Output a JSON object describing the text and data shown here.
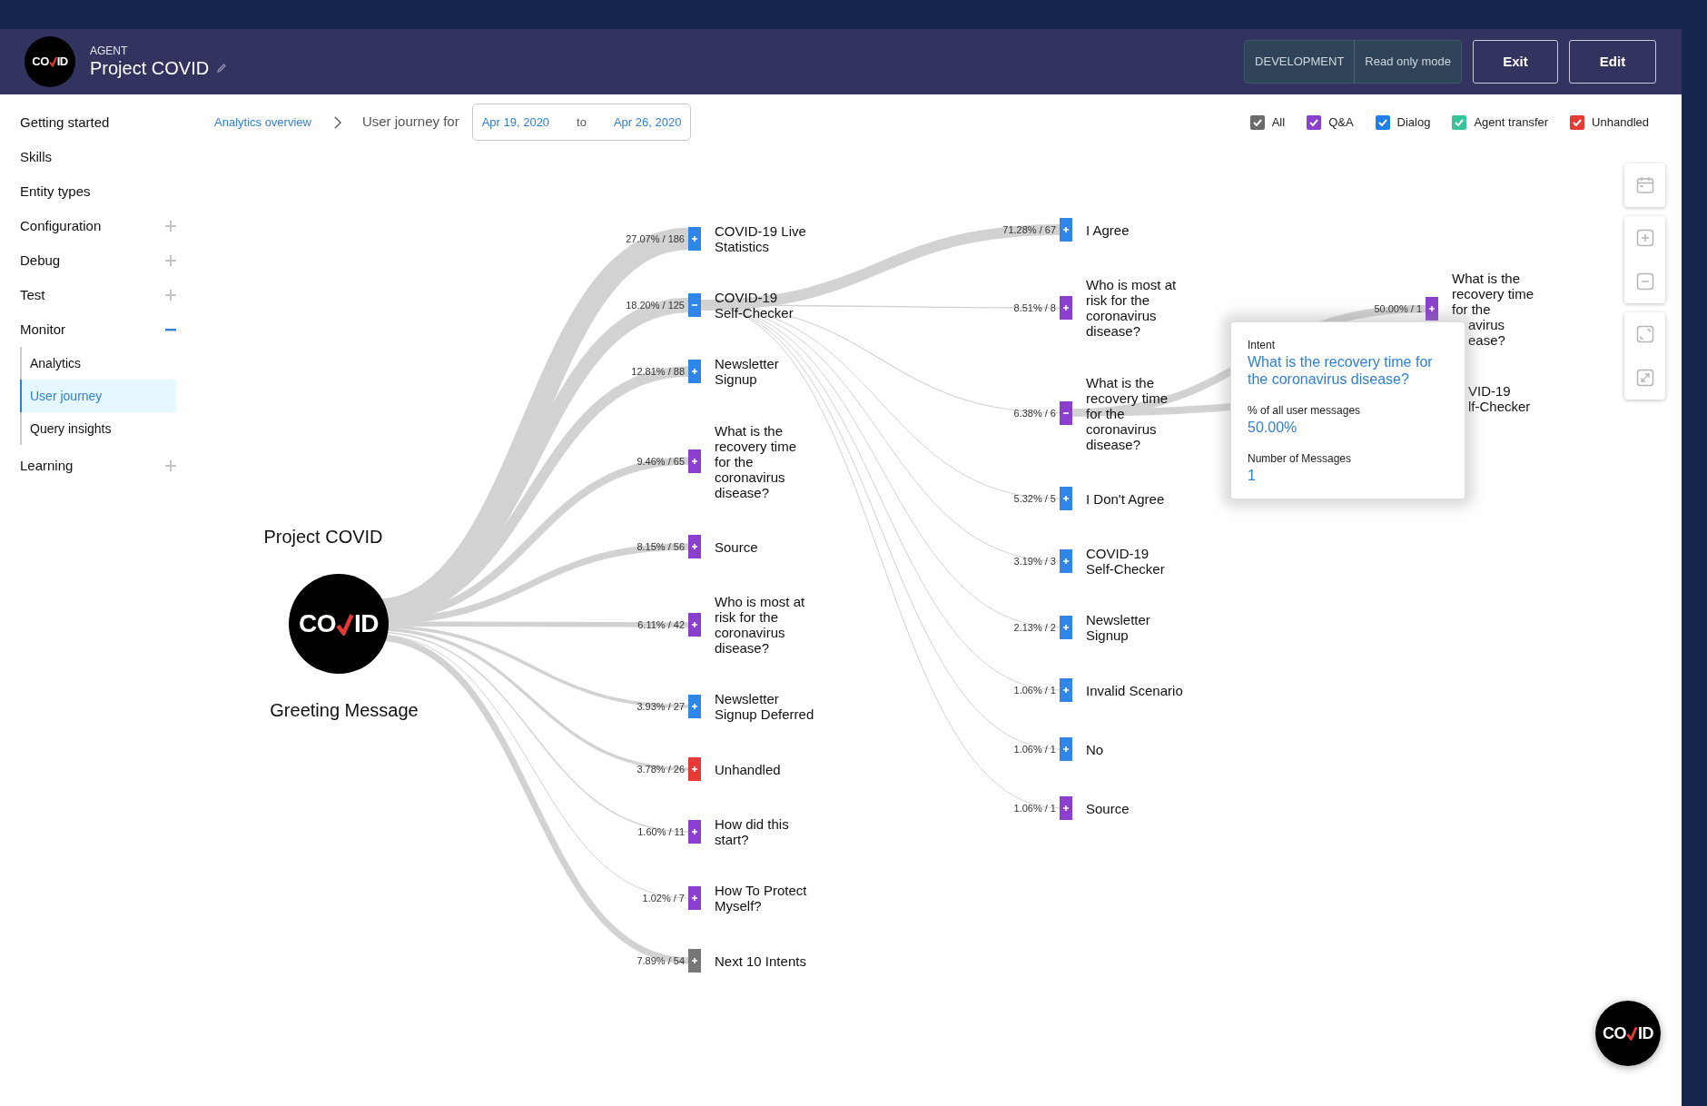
{
  "header": {
    "logo": {
      "left": "CO",
      "right": "ID"
    },
    "eyebrow": "AGENT",
    "title": "Project COVID",
    "environment": "DEVELOPMENT",
    "mode": "Read only mode",
    "buttons": [
      "Exit",
      "Edit"
    ]
  },
  "sidebar": {
    "items": [
      {
        "label": "Getting started",
        "kind": "link"
      },
      {
        "label": "Skills",
        "kind": "link"
      },
      {
        "label": "Entity types",
        "kind": "link"
      },
      {
        "label": "Configuration",
        "kind": "group",
        "expanded": false
      },
      {
        "label": "Debug",
        "kind": "group",
        "expanded": false
      },
      {
        "label": "Test",
        "kind": "group",
        "expanded": false
      },
      {
        "label": "Monitor",
        "kind": "group",
        "expanded": true,
        "children": [
          {
            "label": "Analytics",
            "selected": false
          },
          {
            "label": "User journey",
            "selected": true
          },
          {
            "label": "Query insights",
            "selected": false
          }
        ]
      },
      {
        "label": "Learning",
        "kind": "group",
        "expanded": false
      }
    ]
  },
  "breadcrumb": {
    "link": "Analytics overview",
    "current": "User journey for",
    "date_from": "Apr 19, 2020",
    "date_separator": "to",
    "date_to": "Apr 26, 2020"
  },
  "filters": [
    {
      "label": "All",
      "checked": true,
      "color": "#6b6b6b"
    },
    {
      "label": "Q&A",
      "checked": true,
      "color": "#8a3fcf"
    },
    {
      "label": "Dialog",
      "checked": true,
      "color": "#1f80e8"
    },
    {
      "label": "Agent transfer",
      "checked": true,
      "color": "#38c49b"
    },
    {
      "label": "Unhandled",
      "checked": true,
      "color": "#e53935"
    }
  ],
  "journey": {
    "source": {
      "title": "Project COVID",
      "subtitle": "Greeting Message",
      "logo": {
        "left": "CO",
        "right": "ID"
      }
    },
    "children": [
      {
        "reading": "27.07% / 186",
        "lines": [
          "COVID-19 Live",
          "Statistics"
        ],
        "color": "#2f86e8",
        "expanded": false
      },
      {
        "reading": "18.20% / 125",
        "lines": [
          "COVID-19",
          "Self-Checker"
        ],
        "color": "#2f86e8",
        "expanded": true,
        "children": [
          {
            "reading": "71.28% / 67",
            "lines": [
              "I Agree"
            ],
            "color": "#2f86e8",
            "expanded": false
          },
          {
            "reading": "8.51% / 8",
            "lines": [
              "Who is most at",
              "risk for the",
              "coronavirus",
              "disease?"
            ],
            "color": "#8a3fcf",
            "expanded": false
          },
          {
            "reading": "6.38% / 6",
            "lines": [
              "What is the",
              "recovery time",
              "for the",
              "coronavirus",
              "disease?"
            ],
            "color": "#8a3fcf",
            "expanded": true,
            "children": [
              {
                "reading": "50.00% / 1",
                "lines": [
                  "What is the",
                  "recovery time",
                  "for the",
                  {
                    "text": "avirus",
                    "covered": true
                  },
                  {
                    "text": "ease?",
                    "covered": true
                  }
                ],
                "color": "#8a3fcf",
                "expanded": false
              },
              {
                "lines": [
                  {
                    "text": "VID-19",
                    "covered": true
                  },
                  {
                    "text": "lf-Checker",
                    "covered": true
                  }
                ]
              }
            ]
          },
          {
            "reading": "5.32% / 5",
            "lines": [
              "I Don't Agree"
            ],
            "color": "#2f86e8",
            "expanded": false
          },
          {
            "reading": "3.19% / 3",
            "lines": [
              "COVID-19",
              "Self-Checker"
            ],
            "color": "#2f86e8",
            "expanded": false
          },
          {
            "reading": "2.13% / 2",
            "lines": [
              "Newsletter",
              "Signup"
            ],
            "color": "#2f86e8",
            "expanded": false
          },
          {
            "reading": "1.06% / 1",
            "lines": [
              "Invalid Scenario"
            ],
            "color": "#2f86e8",
            "expanded": false
          },
          {
            "reading": "1.06% / 1",
            "lines": [
              "No"
            ],
            "color": "#2f86e8",
            "expanded": false
          },
          {
            "reading": "1.06% / 1",
            "lines": [
              "Source"
            ],
            "color": "#8a3fcf",
            "expanded": false
          }
        ]
      },
      {
        "reading": "12.81% / 88",
        "lines": [
          "Newsletter",
          "Signup"
        ],
        "color": "#2f86e8",
        "expanded": false
      },
      {
        "reading": "9.46% / 65",
        "lines": [
          "What is the",
          "recovery time",
          "for the",
          "coronavirus",
          "disease?"
        ],
        "color": "#8a3fcf",
        "expanded": false
      },
      {
        "reading": "8.15% / 56",
        "lines": [
          "Source"
        ],
        "color": "#8a3fcf",
        "expanded": false
      },
      {
        "reading": "6.11% / 42",
        "lines": [
          "Who is most at",
          "risk for the",
          "coronavirus",
          "disease?"
        ],
        "color": "#8a3fcf",
        "expanded": false
      },
      {
        "reading": "3.93% / 27",
        "lines": [
          "Newsletter",
          "Signup Deferred"
        ],
        "color": "#2f86e8",
        "expanded": false
      },
      {
        "reading": "3.78% / 26",
        "lines": [
          "Unhandled"
        ],
        "color": "#e53935",
        "expanded": false
      },
      {
        "reading": "1.60% / 11",
        "lines": [
          "How did this",
          "start?"
        ],
        "color": "#8a3fcf",
        "expanded": false
      },
      {
        "reading": "1.02% / 7",
        "lines": [
          "How To Protect",
          "Myself?"
        ],
        "color": "#8a3fcf",
        "expanded": false
      },
      {
        "reading": "7.89% / 54",
        "lines": [
          "Next 10 Intents"
        ],
        "color": "#777777",
        "expanded": false
      }
    ]
  },
  "tooltip": {
    "heading": "Intent",
    "title": "What is the recovery time for the coronavirus disease?",
    "share_label": "% of all user messages",
    "share": "50.00%",
    "count_label": "Number of Messages",
    "count": "1"
  },
  "assistant": {
    "logo": {
      "left": "CO",
      "right": "ID"
    }
  }
}
